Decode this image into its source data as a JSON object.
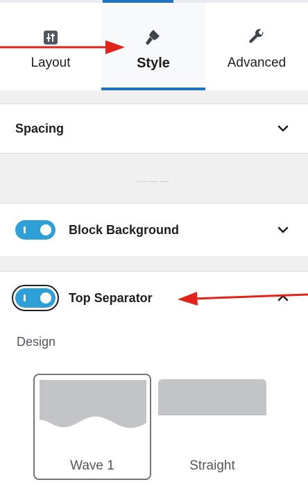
{
  "tabs": [
    {
      "label": "Layout",
      "icon": "layout-sliders-icon",
      "active": false
    },
    {
      "label": "Style",
      "icon": "paintbrush-icon",
      "active": true
    },
    {
      "label": "Advanced",
      "icon": "wrench-icon",
      "active": false
    }
  ],
  "panels": {
    "spacing": {
      "title": "Spacing",
      "expanded": false
    },
    "block_background": {
      "title": "Block Background",
      "toggle_on": true,
      "expanded": false
    },
    "top_separator": {
      "title": "Top Separator",
      "toggle_on": true,
      "expanded": true
    }
  },
  "separator_placeholder": "———",
  "design": {
    "label": "Design",
    "options": [
      {
        "label": "Wave 1",
        "selected": true
      },
      {
        "label": "Straight",
        "selected": false
      }
    ]
  },
  "colors": {
    "accent": "#1e73be",
    "toggle": "#2da0d8",
    "annotation_arrow": "#e2231a",
    "thumb_gray": "#c3c4c7"
  }
}
